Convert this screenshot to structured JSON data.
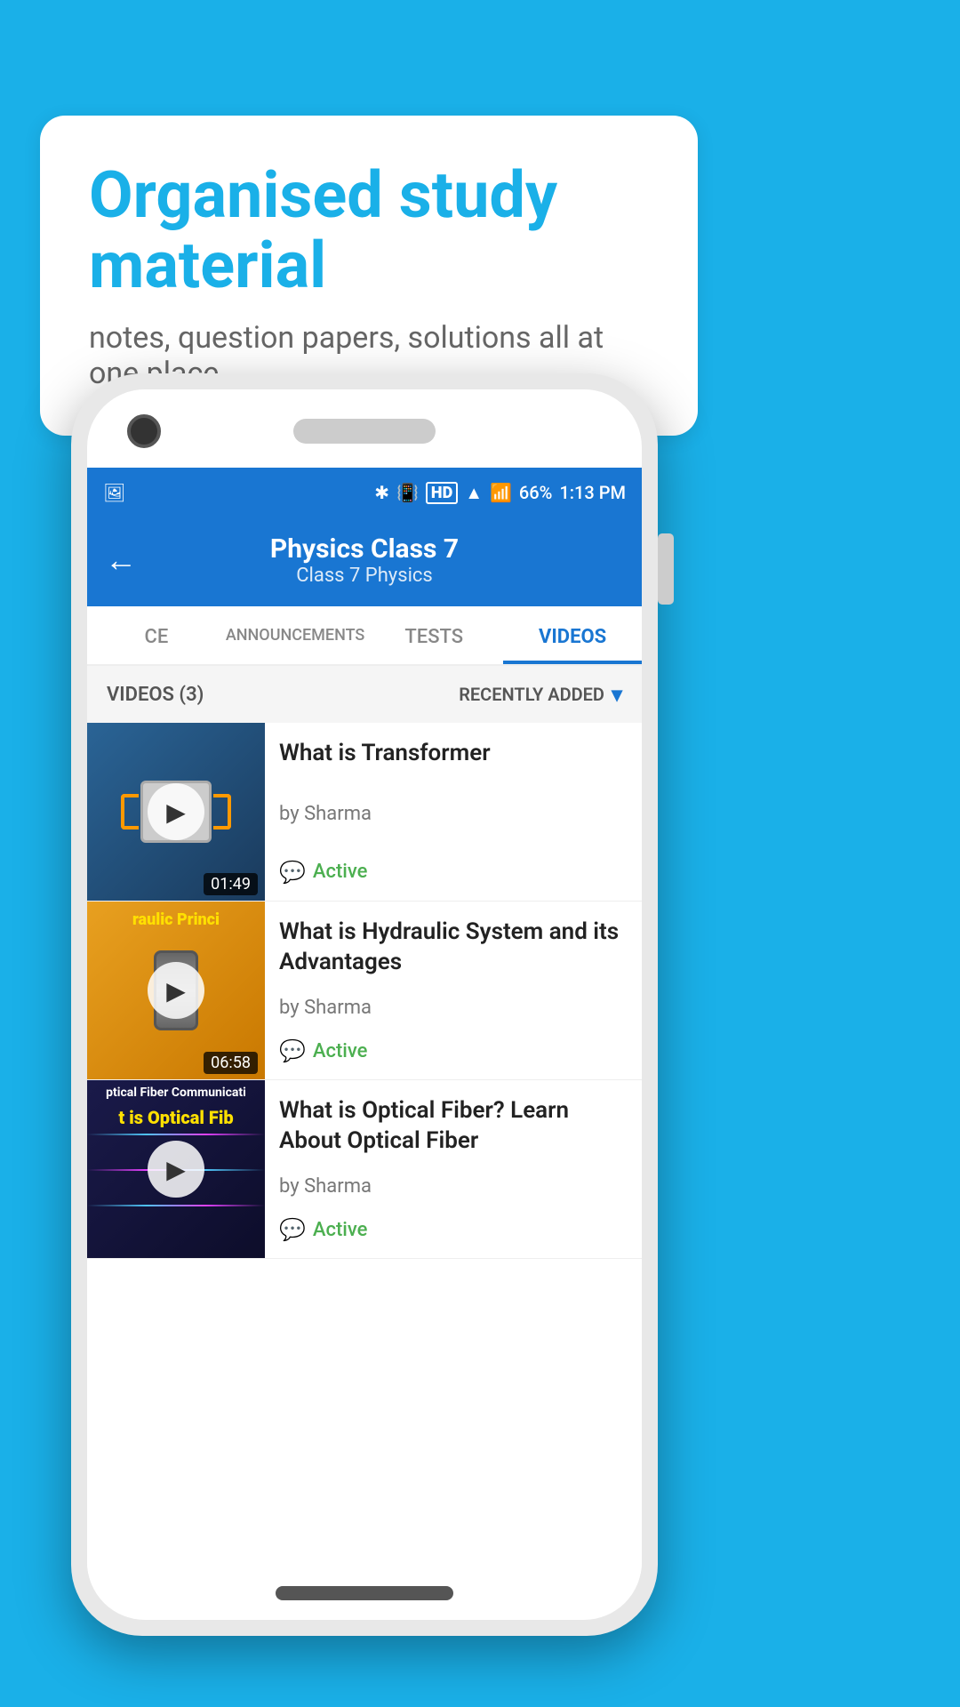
{
  "page": {
    "background_color": "#1ab0e8"
  },
  "bubble": {
    "title": "Organised study material",
    "subtitle": "notes, question papers, solutions all at one place"
  },
  "status_bar": {
    "battery": "66%",
    "time": "1:13 PM",
    "signal": "HD"
  },
  "header": {
    "title": "Physics Class 7",
    "breadcrumb": "Class 7   Physics",
    "back_label": "←"
  },
  "tabs": [
    {
      "id": "ce",
      "label": "CE",
      "active": false
    },
    {
      "id": "announcements",
      "label": "ANNOUNCEMENTS",
      "active": false
    },
    {
      "id": "tests",
      "label": "TESTS",
      "active": false
    },
    {
      "id": "videos",
      "label": "VIDEOS",
      "active": true
    }
  ],
  "filter": {
    "count_label": "VIDEOS (3)",
    "sort_label": "RECENTLY ADDED"
  },
  "videos": [
    {
      "id": "v1",
      "title": "What is  Transformer",
      "author": "by Sharma",
      "status": "Active",
      "duration": "01:49",
      "thumb_type": "transformer"
    },
    {
      "id": "v2",
      "title": "What is Hydraulic System and its Advantages",
      "author": "by Sharma",
      "status": "Active",
      "duration": "06:58",
      "thumb_type": "hydraulic",
      "thumb_label": "raulic Princi"
    },
    {
      "id": "v3",
      "title": "What is Optical Fiber? Learn About Optical Fiber",
      "author": "by Sharma",
      "status": "Active",
      "duration": "",
      "thumb_type": "fiber",
      "thumb_label1": "ptical Fiber Communicati",
      "thumb_label2": "t is Optical Fib"
    }
  ],
  "icons": {
    "play": "▶",
    "back": "←",
    "chevron_down": "▾",
    "chat": "💬",
    "active_icon": "💬"
  }
}
